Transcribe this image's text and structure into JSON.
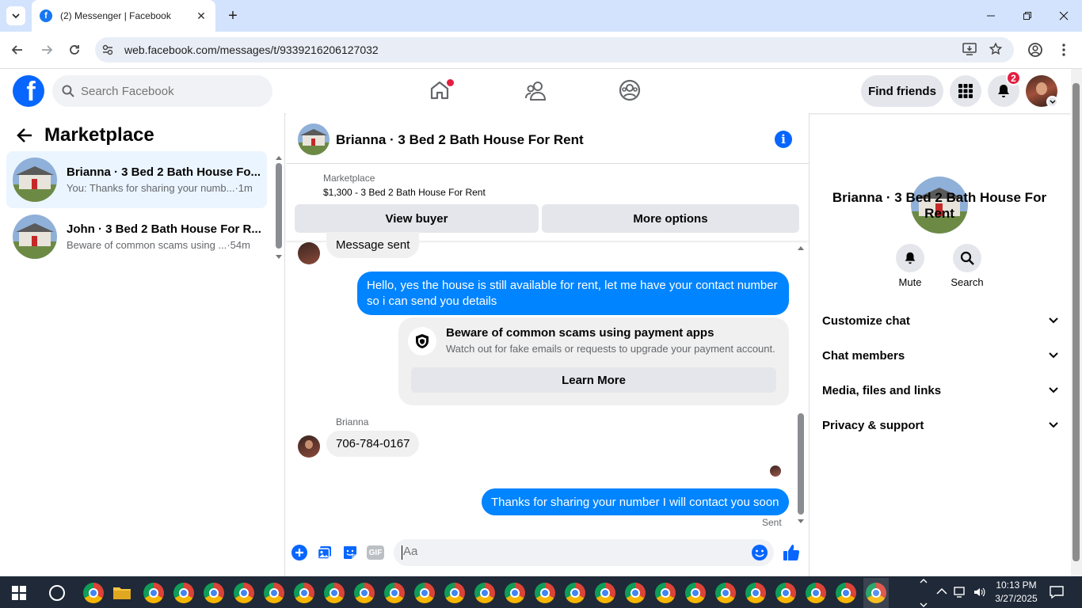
{
  "browser": {
    "tab_title": "(2) Messenger | Facebook",
    "url": "web.facebook.com/messages/t/9339216206127032"
  },
  "fb_header": {
    "search_placeholder": "Search Facebook",
    "find_friends": "Find friends",
    "notif_count": "2"
  },
  "left": {
    "title": "Marketplace",
    "conversations": [
      {
        "name": "Brianna · 3 Bed 2 Bath House Fo...",
        "preview": "You: Thanks for sharing your numb...",
        "time": "·1m"
      },
      {
        "name": "John · 3 Bed 2 Bath House For R...",
        "preview": "Beware of common scams using ...",
        "time": "·54m"
      }
    ]
  },
  "chat": {
    "title": "Brianna · 3 Bed 2 Bath House For Rent",
    "listing": {
      "source": "Marketplace",
      "title": "$1,300 - 3 Bed 2 Bath House For Rent",
      "view_buyer": "View buyer",
      "more_options": "More options"
    },
    "messages": {
      "m0": "Message sent",
      "m1": "Hello, yes the house is still available for rent, let me have your contact number so i can send you  details",
      "scam_title": "Beware of common scams using payment apps",
      "scam_body": "Watch out for fake emails or requests to upgrade your payment account.",
      "learn_more": "Learn More",
      "sender": "Brianna",
      "m2": "706-784-0167",
      "m3": "Thanks for sharing your number I will contact you soon",
      "status": "Sent"
    },
    "composer_placeholder": "Aa",
    "gif_label": "GIF"
  },
  "right": {
    "name": "Brianna · 3 Bed 2 Bath House For Rent",
    "mute": "Mute",
    "search": "Search",
    "sections": [
      "Customize chat",
      "Chat members",
      "Media, files and links",
      "Privacy & support"
    ]
  },
  "taskbar": {
    "time": "10:13 PM",
    "date": "3/27/2025"
  },
  "colors": {
    "fb_blue": "#0866ff",
    "messenger_blue": "#0084ff",
    "chrome_frame": "#d3e3fd",
    "taskbar": "#1f2937"
  }
}
